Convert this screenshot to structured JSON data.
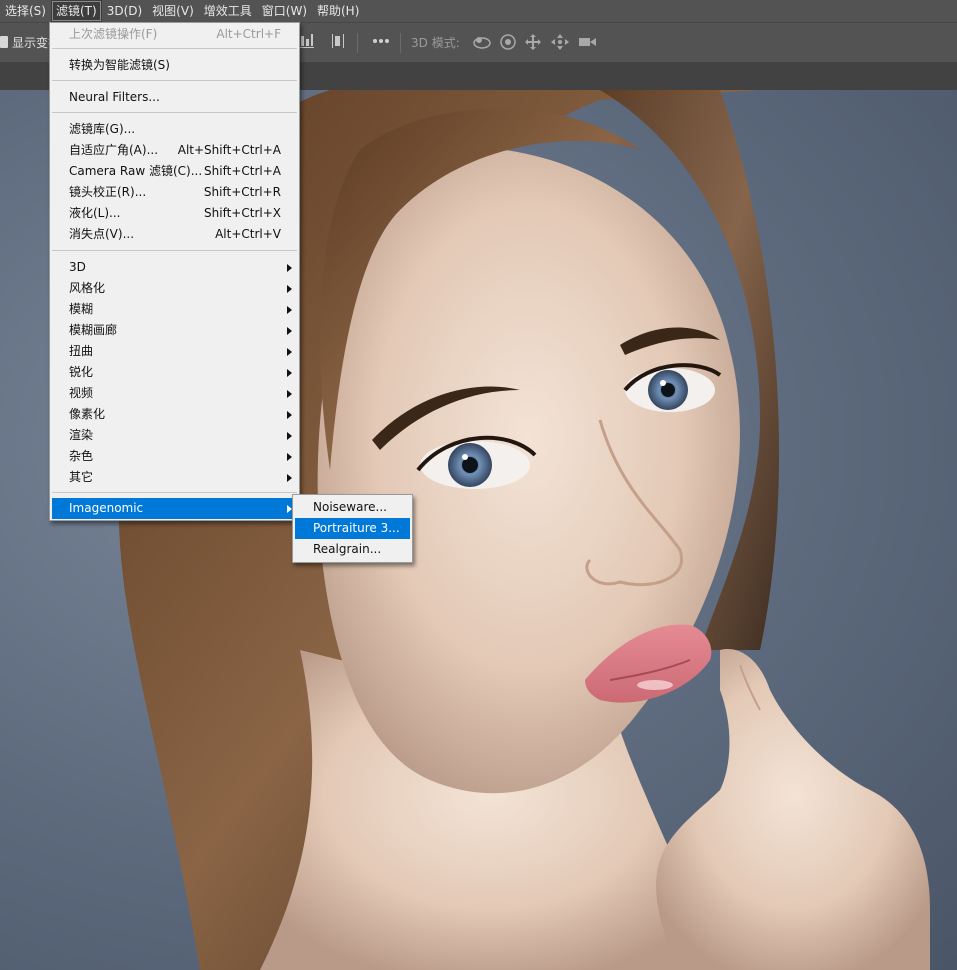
{
  "menubar": {
    "items": [
      "选择(S)",
      "滤镜(T)",
      "3D(D)",
      "视图(V)",
      "增效工具",
      "窗口(W)",
      "帮助(H)"
    ],
    "active_index": 1
  },
  "options_bar": {
    "show_transform_label": "显示变换",
    "mode_label": "3D 模式:",
    "more_icon": "more-dots-icon",
    "icons_3d": [
      "orbit-icon",
      "roll-icon",
      "pan-icon",
      "slide-icon",
      "camera-scale-icon"
    ]
  },
  "filter_menu": {
    "last_filter": {
      "label": "上次滤镜操作(F)",
      "shortcut": "Alt+Ctrl+F"
    },
    "smart_filter": {
      "label": "转换为智能滤镜(S)"
    },
    "neural_filters": {
      "label": "Neural Filters..."
    },
    "filter_gallery": {
      "label": "滤镜库(G)..."
    },
    "adaptive_wide_angle": {
      "label": "自适应广角(A)...",
      "shortcut": "Alt+Shift+Ctrl+A"
    },
    "camera_raw": {
      "label": "Camera Raw 滤镜(C)...",
      "shortcut": "Shift+Ctrl+A"
    },
    "lens_correction": {
      "label": "镜头校正(R)...",
      "shortcut": "Shift+Ctrl+R"
    },
    "liquify": {
      "label": "液化(L)...",
      "shortcut": "Shift+Ctrl+X"
    },
    "vanishing_point": {
      "label": "消失点(V)...",
      "shortcut": "Alt+Ctrl+V"
    },
    "submenus": [
      "3D",
      "风格化",
      "模糊",
      "模糊画廊",
      "扭曲",
      "锐化",
      "视频",
      "像素化",
      "渲染",
      "杂色",
      "其它"
    ],
    "imagenomic": {
      "label": "Imagenomic"
    }
  },
  "imagenomic_submenu": {
    "items": [
      "Noiseware...",
      "Portraiture 3...",
      "Realgrain..."
    ],
    "highlighted_index": 1
  },
  "colors": {
    "menu_highlight": "#0078d7",
    "app_chrome": "#535353",
    "menu_background": "#f0f0f0"
  }
}
